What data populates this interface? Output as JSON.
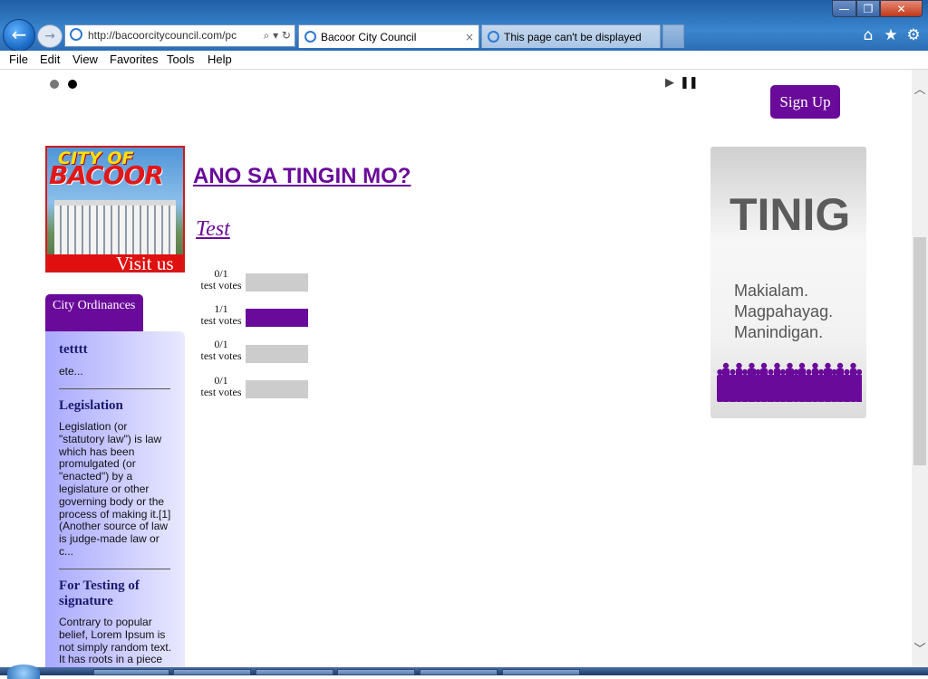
{
  "browser": {
    "address_url": "http://bacoorcitycouncil.com/pc",
    "tabs": [
      {
        "title": "Bacoor City Council",
        "active": true
      },
      {
        "title": "This page can't be displayed",
        "active": false
      }
    ],
    "tab_close_glyph": "×",
    "window_buttons": {
      "minimize": "—",
      "maximize": "❐",
      "close": "✕"
    },
    "nav": {
      "back": "←",
      "forward": "→"
    },
    "tool_icons": [
      "home-icon",
      "favorites-star-icon",
      "settings-gear-icon"
    ],
    "address_tools": "⌕ ▾ ↻"
  },
  "menu": [
    "File",
    "Edit",
    "View",
    "Favorites",
    "Tools",
    "Help"
  ],
  "slider": {
    "dots": 2,
    "active_dot": 1,
    "play": "▶",
    "pause": "❚❚"
  },
  "header": {
    "signup_label": "Sign Up"
  },
  "banner": {
    "line1": "CITY OF",
    "line2": "BACOOR",
    "visit": "Visit us"
  },
  "ordinances": {
    "tab_label": "City Ordinances",
    "items": [
      {
        "title": "tetttt",
        "excerpt": "ete..."
      },
      {
        "title": "Legislation",
        "excerpt": "Legislation (or \"statutory law\") is law which has been promulgated (or \"enacted\") by a legislature or other governing body or the process of making it.[1] (Another source of law is judge-made law or c..."
      },
      {
        "title": "For Testing of signature",
        "excerpt": "Contrary to popular belief, Lorem Ipsum is not simply random text. It has roots in a piece"
      }
    ]
  },
  "poll": {
    "heading": "ANO SA TINGIN MO?",
    "question": "Test",
    "options": [
      {
        "count": "0/1",
        "label": "test votes",
        "fraction": 0
      },
      {
        "count": "1/1",
        "label": "test votes",
        "fraction": 1
      },
      {
        "count": "0/1",
        "label": "test votes",
        "fraction": 0
      },
      {
        "count": "0/1",
        "label": "test votes",
        "fraction": 0
      }
    ],
    "bar_color": "#6a0a9a",
    "bar_empty_color": "#cccccc"
  },
  "ad": {
    "title": "TINIG",
    "lines": [
      "Makialam.",
      "Magpahayag.",
      "Manindigan."
    ],
    "crowd_color": "#6a0a9a"
  },
  "colors": {
    "accent": "#6a0a9a",
    "banner_red": "#e01010"
  }
}
